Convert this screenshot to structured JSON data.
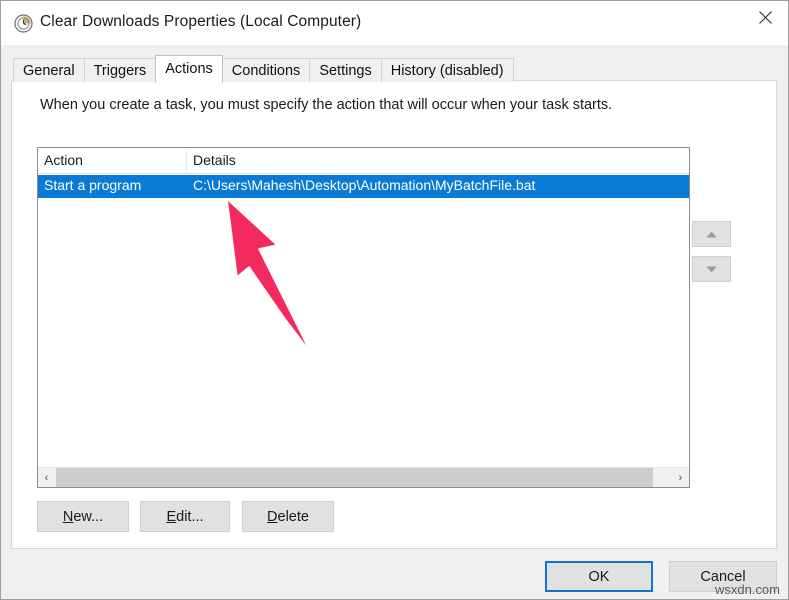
{
  "window": {
    "title": "Clear Downloads Properties (Local Computer)",
    "icon": "clock-icon",
    "close_label": "close-icon"
  },
  "tabs": [
    {
      "label": "General",
      "selected": false
    },
    {
      "label": "Triggers",
      "selected": false
    },
    {
      "label": "Actions",
      "selected": true
    },
    {
      "label": "Conditions",
      "selected": false
    },
    {
      "label": "Settings",
      "selected": false
    },
    {
      "label": "History (disabled)",
      "selected": false
    }
  ],
  "main": {
    "instruction": "When you create a task, you must specify the action that will occur when your task starts.",
    "list": {
      "columns": [
        "Action",
        "Details"
      ],
      "rows": [
        {
          "action": "Start a program",
          "details": "C:\\Users\\Mahesh\\Desktop\\Automation\\MyBatchFile.bat",
          "selected": true
        }
      ],
      "scrollbar": {
        "left_arrow": "‹",
        "right_arrow": "›"
      }
    },
    "reorder": {
      "up_label": "move-up",
      "down_label": "move-down"
    },
    "buttons": [
      {
        "prefix": "",
        "accel": "N",
        "suffix": "ew..."
      },
      {
        "prefix": "",
        "accel": "E",
        "suffix": "dit..."
      },
      {
        "prefix": "",
        "accel": "D",
        "suffix": "elete"
      }
    ]
  },
  "footer": {
    "ok_label": "OK",
    "cancel_label": "Cancel"
  },
  "annotation": {
    "arrow_color": "#F42A5F"
  },
  "watermark": "wsxdn.com",
  "colors": {
    "selection_blue": "#0a7bd4",
    "focus_border": "#1273d2",
    "dialog_bg": "#f0f0f0"
  }
}
